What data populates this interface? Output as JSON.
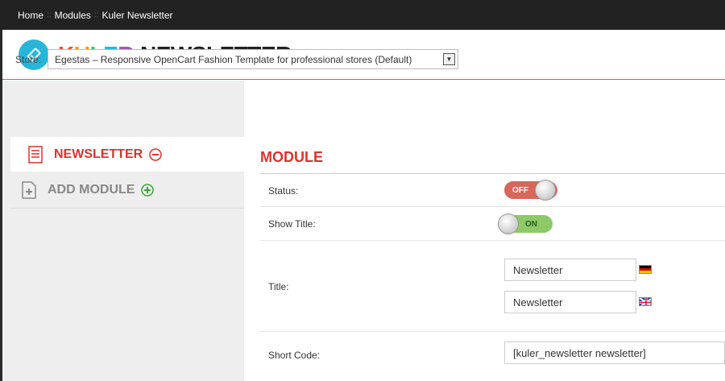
{
  "breadcrumb": {
    "items": [
      "Home",
      "Modules",
      "Kuler Newsletter"
    ],
    "separator": "::"
  },
  "header": {
    "brand_prefix": [
      "K",
      "U",
      "L",
      "E",
      "R"
    ],
    "brand_rest": "NEWSLETTER",
    "logo_icon": "ticket-icon"
  },
  "store": {
    "label": "Store:",
    "value": "Egestas – Responsive OpenCart Fashion Template for professional stores (Default)"
  },
  "sidebar": {
    "active_tab": "NEWSLETTER",
    "add_tab": "ADD MODULE"
  },
  "module": {
    "title": "MODULE",
    "status_label": "Status:",
    "status_value": "OFF",
    "show_title_label": "Show Title:",
    "show_title_value": "ON",
    "title_label": "Title:",
    "title_values": [
      "Newsletter",
      "Newsletter"
    ],
    "title_flags": [
      "de-flag-icon",
      "gb-flag-icon"
    ],
    "short_code_label": "Short Code:",
    "short_code_value": "[kuler_newsletter newsletter]"
  },
  "colors": {
    "accent": "#d9342b",
    "logo": "#27b6d9",
    "on": "#8fc866",
    "off": "#d9665a"
  }
}
